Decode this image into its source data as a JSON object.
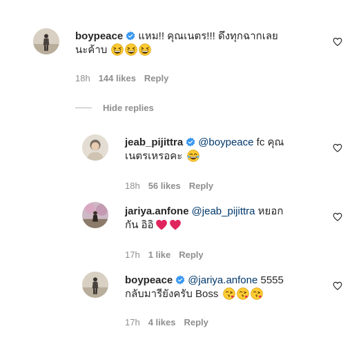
{
  "comments": [
    {
      "username": "boypeace",
      "verified": true,
      "mention": "",
      "line1": "แหม!! คุณเนตร!!! ดึงทุกฉากเลย",
      "line2": "นะค้าบ",
      "emoji": "grinning-squint-face",
      "emoji_count": 3,
      "time": "18h",
      "likes": "144 likes",
      "reply": "Reply"
    },
    {
      "username": "jeab_pijittra",
      "verified": true,
      "mention": "@boypeace",
      "line1": "fc คุณ",
      "line2": "เนตรเหรอคะ",
      "emoji": "tears-of-joy-face",
      "emoji_count": 1,
      "time": "18h",
      "likes": "56 likes",
      "reply": "Reply"
    },
    {
      "username": "jariya.anfone",
      "verified": false,
      "mention": "@jeab_pijittra",
      "line1": "หยอก",
      "line2": "กัน อิอิ",
      "emoji": "red-heart",
      "emoji_count": 2,
      "time": "17h",
      "likes": "1 like",
      "reply": "Reply"
    },
    {
      "username": "boypeace",
      "verified": true,
      "mention": "@jariya.anfone",
      "line1": "5555",
      "line2": "กลับมารียังครับ Boss",
      "emoji": "face-blowing-kiss",
      "emoji_count": 3,
      "time": "17h",
      "likes": "4 likes",
      "reply": "Reply"
    }
  ],
  "hide_replies_label": "Hide replies",
  "colors": {
    "text": "#262626",
    "secondary": "#8e8e8e",
    "mention": "#00376b",
    "verified": "#3897f0",
    "heart": "#e0245e"
  }
}
